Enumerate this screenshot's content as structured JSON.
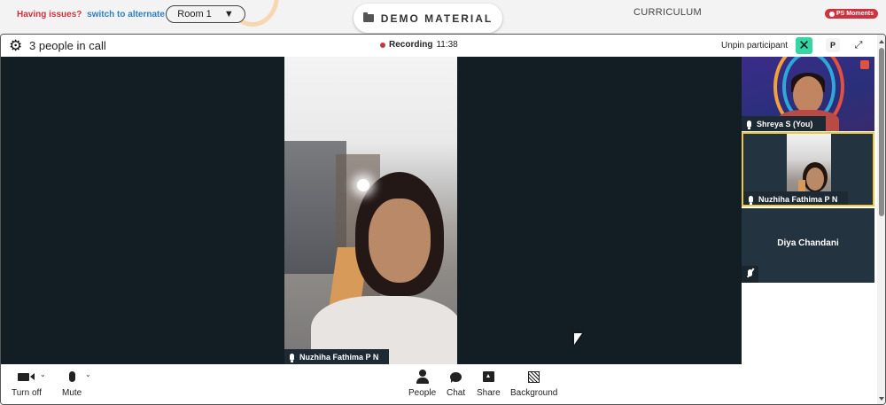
{
  "header": {
    "issues_text": "Having issues?",
    "switch_link": "switch to alternate room",
    "room_select_value": "Room 1",
    "demo_tab_label": "DEMO MATERIAL",
    "curriculum_label": "CURRICULUM",
    "ps_moments_badge": "PS Moments"
  },
  "call": {
    "people_count": "3 people in call",
    "recording_label": "Recording",
    "recording_time": "11:38",
    "unpin_label": "Unpin participant",
    "p_button_label": "P"
  },
  "main_video": {
    "participant_name": "Nuzhiha Fathima P N"
  },
  "participants": [
    {
      "name": "Shreya S (You)"
    },
    {
      "name": "Nuzhiha Fathima P N"
    },
    {
      "name": "Diya Chandani"
    }
  ],
  "toolbar": {
    "turn_off_label": "Turn off",
    "mute_label": "Mute",
    "people_label": "People",
    "chat_label": "Chat",
    "share_label": "Share",
    "background_label": "Background"
  },
  "colors": {
    "accent_red": "#d0313f",
    "accent_blue": "#2f7fc4",
    "unpin_green": "#36d6a4",
    "active_border": "#f0c93a",
    "stage_bg": "#131d24"
  }
}
